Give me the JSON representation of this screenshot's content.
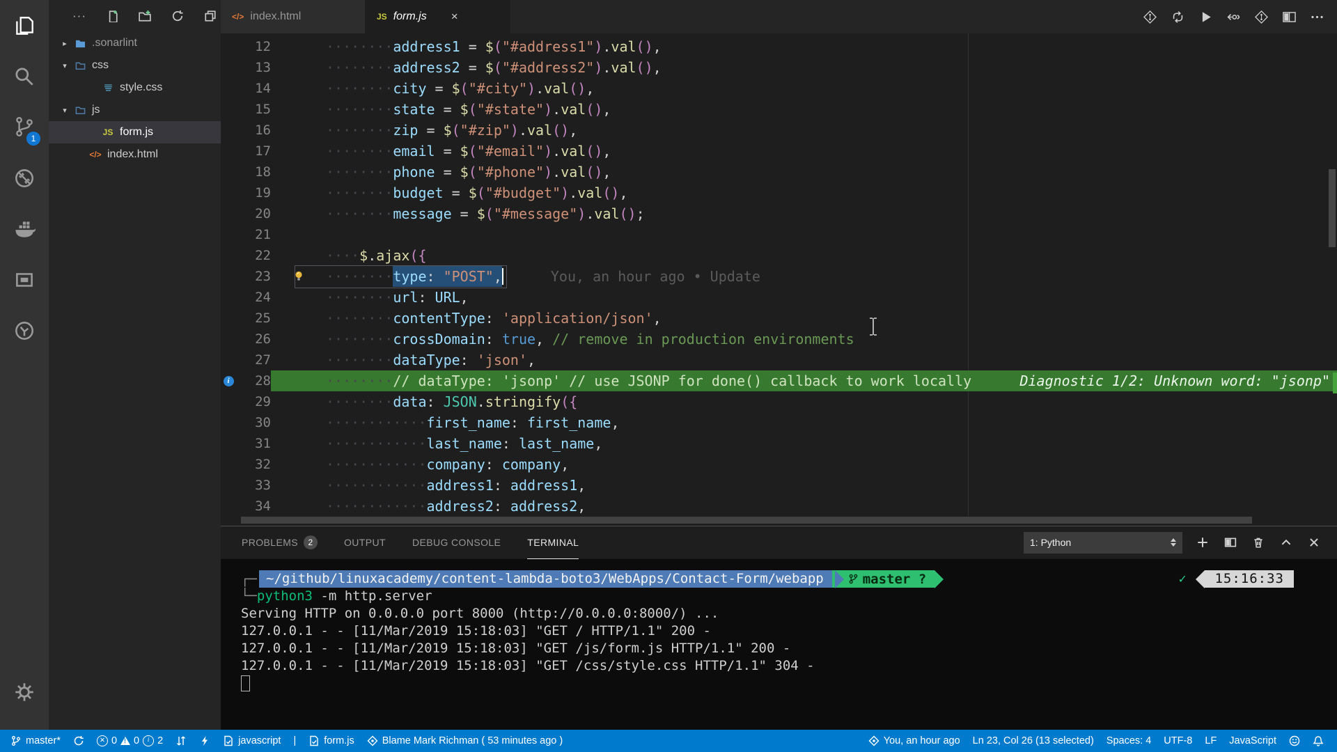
{
  "activity_bar": {
    "items": [
      {
        "name": "explorer",
        "icon": "files",
        "active": true,
        "badge": ""
      },
      {
        "name": "search",
        "icon": "search",
        "active": false,
        "badge": ""
      },
      {
        "name": "source-control",
        "icon": "scm",
        "active": false,
        "badge": "1"
      },
      {
        "name": "sonarlint",
        "icon": "block",
        "active": false,
        "badge": ""
      },
      {
        "name": "docker",
        "icon": "docker",
        "active": false,
        "badge": ""
      },
      {
        "name": "extension-box",
        "icon": "boxed",
        "active": false,
        "badge": ""
      },
      {
        "name": "extension-circle",
        "icon": "circtool",
        "active": false,
        "badge": ""
      }
    ],
    "settings": {
      "name": "manage",
      "icon": "gear"
    }
  },
  "sidebar": {
    "actions": [
      {
        "name": "more-actions",
        "icon": "more"
      },
      {
        "name": "new-file",
        "icon": "newfile"
      },
      {
        "name": "new-folder",
        "icon": "newfolder"
      },
      {
        "name": "refresh-explorer",
        "icon": "refresh"
      },
      {
        "name": "collapse-folders",
        "icon": "collapse"
      }
    ],
    "tree": [
      {
        "label": ".sonarlint",
        "icon": "folder-solid",
        "chevron": "right",
        "indent": 0,
        "selected": false,
        "dim": true
      },
      {
        "label": "css",
        "icon": "folder-outline",
        "chevron": "down",
        "indent": 0,
        "selected": false,
        "dim": false
      },
      {
        "label": "style.css",
        "icon": "css",
        "chevron": "",
        "indent": 1,
        "selected": false,
        "dim": false
      },
      {
        "label": "js",
        "icon": "folder-outline",
        "chevron": "down",
        "indent": 0,
        "selected": false,
        "dim": false
      },
      {
        "label": "form.js",
        "icon": "js",
        "chevron": "",
        "indent": 1,
        "selected": true,
        "dim": false
      },
      {
        "label": "index.html",
        "icon": "html",
        "chevron": "",
        "indent": 0.55,
        "selected": false,
        "dim": false
      }
    ]
  },
  "tabs": [
    {
      "label": "index.html",
      "icon": "html",
      "icon_text": "</>",
      "active": false,
      "italic": false,
      "close": false
    },
    {
      "label": "form.js",
      "icon": "js",
      "icon_text": "JS",
      "active": true,
      "italic": true,
      "close": true
    }
  ],
  "editor_actions": [
    {
      "name": "gitlens-file-blame",
      "icon": "diamond"
    },
    {
      "name": "synchronize-changes",
      "icon": "syncarrows"
    },
    {
      "name": "run-code",
      "icon": "play"
    },
    {
      "name": "open-changes",
      "icon": "openchanges"
    },
    {
      "name": "gitlens-graph",
      "icon": "diamond"
    },
    {
      "name": "split-editor",
      "icon": "spliteditor"
    },
    {
      "name": "more-actions",
      "icon": "ellipsis"
    }
  ],
  "editor": {
    "blame_ghost": "You, an hour ago • Update",
    "diagnostic": "Diagnostic 1/2: Unknown word: \"jsonp\"",
    "lines": [
      {
        "num": "12",
        "tokens": [
          [
            "w",
            "········"
          ],
          [
            "v",
            "address1"
          ],
          [
            "o",
            " = "
          ],
          [
            "f",
            "$"
          ],
          [
            "p",
            "("
          ],
          [
            "s",
            "\"#address1\""
          ],
          [
            "p",
            ")"
          ],
          [
            "o",
            "."
          ],
          [
            "f",
            "val"
          ],
          [
            "p",
            "()"
          ],
          [
            "o",
            ","
          ]
        ]
      },
      {
        "num": "13",
        "tokens": [
          [
            "w",
            "········"
          ],
          [
            "v",
            "address2"
          ],
          [
            "o",
            " = "
          ],
          [
            "f",
            "$"
          ],
          [
            "p",
            "("
          ],
          [
            "s",
            "\"#address2\""
          ],
          [
            "p",
            ")"
          ],
          [
            "o",
            "."
          ],
          [
            "f",
            "val"
          ],
          [
            "p",
            "()"
          ],
          [
            "o",
            ","
          ]
        ]
      },
      {
        "num": "14",
        "tokens": [
          [
            "w",
            "········"
          ],
          [
            "v",
            "city"
          ],
          [
            "o",
            " = "
          ],
          [
            "f",
            "$"
          ],
          [
            "p",
            "("
          ],
          [
            "s",
            "\"#city\""
          ],
          [
            "p",
            ")"
          ],
          [
            "o",
            "."
          ],
          [
            "f",
            "val"
          ],
          [
            "p",
            "()"
          ],
          [
            "o",
            ","
          ]
        ]
      },
      {
        "num": "15",
        "tokens": [
          [
            "w",
            "········"
          ],
          [
            "v",
            "state"
          ],
          [
            "o",
            " = "
          ],
          [
            "f",
            "$"
          ],
          [
            "p",
            "("
          ],
          [
            "s",
            "\"#state\""
          ],
          [
            "p",
            ")"
          ],
          [
            "o",
            "."
          ],
          [
            "f",
            "val"
          ],
          [
            "p",
            "()"
          ],
          [
            "o",
            ","
          ]
        ]
      },
      {
        "num": "16",
        "tokens": [
          [
            "w",
            "········"
          ],
          [
            "v",
            "zip"
          ],
          [
            "o",
            " = "
          ],
          [
            "f",
            "$"
          ],
          [
            "p",
            "("
          ],
          [
            "s",
            "\"#zip\""
          ],
          [
            "p",
            ")"
          ],
          [
            "o",
            "."
          ],
          [
            "f",
            "val"
          ],
          [
            "p",
            "()"
          ],
          [
            "o",
            ","
          ]
        ]
      },
      {
        "num": "17",
        "tokens": [
          [
            "w",
            "········"
          ],
          [
            "v",
            "email"
          ],
          [
            "o",
            " = "
          ],
          [
            "f",
            "$"
          ],
          [
            "p",
            "("
          ],
          [
            "s",
            "\"#email\""
          ],
          [
            "p",
            ")"
          ],
          [
            "o",
            "."
          ],
          [
            "f",
            "val"
          ],
          [
            "p",
            "()"
          ],
          [
            "o",
            ","
          ]
        ]
      },
      {
        "num": "18",
        "tokens": [
          [
            "w",
            "········"
          ],
          [
            "v",
            "phone"
          ],
          [
            "o",
            " = "
          ],
          [
            "f",
            "$"
          ],
          [
            "p",
            "("
          ],
          [
            "s",
            "\"#phone\""
          ],
          [
            "p",
            ")"
          ],
          [
            "o",
            "."
          ],
          [
            "f",
            "val"
          ],
          [
            "p",
            "()"
          ],
          [
            "o",
            ","
          ]
        ]
      },
      {
        "num": "19",
        "tokens": [
          [
            "w",
            "········"
          ],
          [
            "v",
            "budget"
          ],
          [
            "o",
            " = "
          ],
          [
            "f",
            "$"
          ],
          [
            "p",
            "("
          ],
          [
            "s",
            "\"#budget\""
          ],
          [
            "p",
            ")"
          ],
          [
            "o",
            "."
          ],
          [
            "f",
            "val"
          ],
          [
            "p",
            "()"
          ],
          [
            "o",
            ","
          ]
        ]
      },
      {
        "num": "20",
        "tokens": [
          [
            "w",
            "········"
          ],
          [
            "v",
            "message"
          ],
          [
            "o",
            " = "
          ],
          [
            "f",
            "$"
          ],
          [
            "p",
            "("
          ],
          [
            "s",
            "\"#message\""
          ],
          [
            "p",
            ")"
          ],
          [
            "o",
            "."
          ],
          [
            "f",
            "val"
          ],
          [
            "p",
            "()"
          ],
          [
            "o",
            ";"
          ]
        ]
      },
      {
        "num": "21",
        "tokens": []
      },
      {
        "num": "22",
        "tokens": [
          [
            "w",
            "····"
          ],
          [
            "f",
            "$"
          ],
          [
            "o",
            "."
          ],
          [
            "f",
            "ajax"
          ],
          [
            "p",
            "({"
          ]
        ]
      },
      {
        "num": "23",
        "bulb": true,
        "blame": true,
        "tokens": [
          [
            "w",
            "········"
          ],
          [
            "v sel",
            "type"
          ],
          [
            "o sel",
            ": "
          ],
          [
            "s sel",
            "\"POST\""
          ],
          [
            "o sel",
            ","
          ],
          [
            "cursor",
            ""
          ]
        ]
      },
      {
        "num": "24",
        "tokens": [
          [
            "w",
            "········"
          ],
          [
            "v",
            "url"
          ],
          [
            "o",
            ": "
          ],
          [
            "v",
            "URL"
          ],
          [
            "o",
            ","
          ]
        ]
      },
      {
        "num": "25",
        "tokens": [
          [
            "w",
            "········"
          ],
          [
            "v",
            "contentType"
          ],
          [
            "o",
            ": "
          ],
          [
            "s",
            "'application/json'"
          ],
          [
            "o",
            ","
          ]
        ]
      },
      {
        "num": "26",
        "tokens": [
          [
            "w",
            "········"
          ],
          [
            "v",
            "crossDomain"
          ],
          [
            "o",
            ": "
          ],
          [
            "k",
            "true"
          ],
          [
            "o",
            ", "
          ],
          [
            "c",
            "// remove in production environments"
          ]
        ]
      },
      {
        "num": "27",
        "tokens": [
          [
            "w",
            "········"
          ],
          [
            "v",
            "dataType"
          ],
          [
            "o",
            ": "
          ],
          [
            "s",
            "'json'"
          ],
          [
            "o",
            ","
          ]
        ]
      },
      {
        "num": "28",
        "green": true,
        "info": true,
        "diag": true,
        "tokens": [
          [
            "w",
            "········"
          ],
          [
            "gc",
            "// dataType: 'jsonp' // use JSONP for done() callback to work locally"
          ]
        ]
      },
      {
        "num": "29",
        "tokens": [
          [
            "w",
            "········"
          ],
          [
            "v",
            "data"
          ],
          [
            "o",
            ": "
          ],
          [
            "t",
            "JSON"
          ],
          [
            "o",
            "."
          ],
          [
            "f",
            "stringify"
          ],
          [
            "p",
            "({"
          ]
        ]
      },
      {
        "num": "30",
        "tokens": [
          [
            "w",
            "············"
          ],
          [
            "v",
            "first_name"
          ],
          [
            "o",
            ": "
          ],
          [
            "v",
            "first_name"
          ],
          [
            "o",
            ","
          ]
        ]
      },
      {
        "num": "31",
        "tokens": [
          [
            "w",
            "············"
          ],
          [
            "v",
            "last_name"
          ],
          [
            "o",
            ": "
          ],
          [
            "v",
            "last_name"
          ],
          [
            "o",
            ","
          ]
        ]
      },
      {
        "num": "32",
        "tokens": [
          [
            "w",
            "············"
          ],
          [
            "v",
            "company"
          ],
          [
            "o",
            ": "
          ],
          [
            "v",
            "company"
          ],
          [
            "o",
            ","
          ]
        ]
      },
      {
        "num": "33",
        "tokens": [
          [
            "w",
            "············"
          ],
          [
            "v",
            "address1"
          ],
          [
            "o",
            ": "
          ],
          [
            "v",
            "address1"
          ],
          [
            "o",
            ","
          ]
        ]
      },
      {
        "num": "34",
        "tokens": [
          [
            "w",
            "············"
          ],
          [
            "v",
            "address2"
          ],
          [
            "o",
            ": "
          ],
          [
            "v",
            "address2"
          ],
          [
            "o",
            ","
          ]
        ]
      }
    ]
  },
  "panel": {
    "tabs": [
      {
        "label": "PROBLEMS",
        "badge": "2",
        "active": false
      },
      {
        "label": "OUTPUT",
        "badge": "",
        "active": false
      },
      {
        "label": "DEBUG CONSOLE",
        "badge": "",
        "active": false
      },
      {
        "label": "TERMINAL",
        "badge": "",
        "active": true
      }
    ],
    "picker_value": "1: Python",
    "controls": [
      {
        "name": "new-terminal",
        "icon": "plus"
      },
      {
        "name": "split-terminal",
        "icon": "splitpanel"
      },
      {
        "name": "kill-terminal",
        "icon": "trash"
      },
      {
        "name": "maximize-panel",
        "icon": "chevup"
      },
      {
        "name": "close-panel",
        "icon": "closex"
      }
    ]
  },
  "terminal": {
    "path": "~/github/linuxacademy/content-lambda-boto3/WebApps/Contact-Form/webapp",
    "branch": "master ?",
    "check": "✓",
    "time": "15:16:33",
    "bracket_top": "┌─",
    "bracket_bottom": "└─",
    "command_bin": "python3",
    "command_rest": " -m http.server",
    "lines": [
      "Serving HTTP on 0.0.0.0 port 8000 (http://0.0.0.0:8000/) ...",
      "127.0.0.1 - - [11/Mar/2019 15:18:03] \"GET / HTTP/1.1\" 200 -",
      "127.0.0.1 - - [11/Mar/2019 15:18:03] \"GET /js/form.js HTTP/1.1\" 200 -",
      "127.0.0.1 - - [11/Mar/2019 15:18:03] \"GET /css/style.css HTTP/1.1\" 304 -"
    ]
  },
  "status_bar": {
    "left": [
      {
        "name": "git-branch",
        "icon": "branch",
        "text": "master*"
      },
      {
        "name": "sync-status",
        "icon": "sync",
        "text": ""
      },
      {
        "name": "problems",
        "icon": "problems",
        "errors": "0",
        "warnings": "0",
        "infos": "2"
      },
      {
        "name": "compare",
        "icon": "compare",
        "text": ""
      },
      {
        "name": "lightning",
        "icon": "bolt",
        "text": ""
      },
      {
        "name": "linter-javascript",
        "icon": "pagecheck",
        "text": "javascript"
      },
      {
        "name": "separator",
        "icon": "",
        "text": "|"
      },
      {
        "name": "linter-file",
        "icon": "pagecheck",
        "text": "form.js"
      },
      {
        "name": "gitlens-blame",
        "icon": "gitlens",
        "text": "Blame Mark Richman ( 53 minutes ago )"
      }
    ],
    "right": [
      {
        "name": "gitlens-current-line",
        "icon": "gitlens",
        "text": "You, an hour ago"
      },
      {
        "name": "cursor-position",
        "icon": "",
        "text": "Ln 23, Col 26 (13 selected)"
      },
      {
        "name": "indentation",
        "icon": "",
        "text": "Spaces: 4"
      },
      {
        "name": "encoding",
        "icon": "",
        "text": "UTF-8"
      },
      {
        "name": "eol",
        "icon": "",
        "text": "LF"
      },
      {
        "name": "language-mode",
        "icon": "",
        "text": "JavaScript"
      },
      {
        "name": "feedback",
        "icon": "smiley",
        "text": ""
      },
      {
        "name": "notifications",
        "icon": "bell",
        "text": ""
      }
    ]
  }
}
